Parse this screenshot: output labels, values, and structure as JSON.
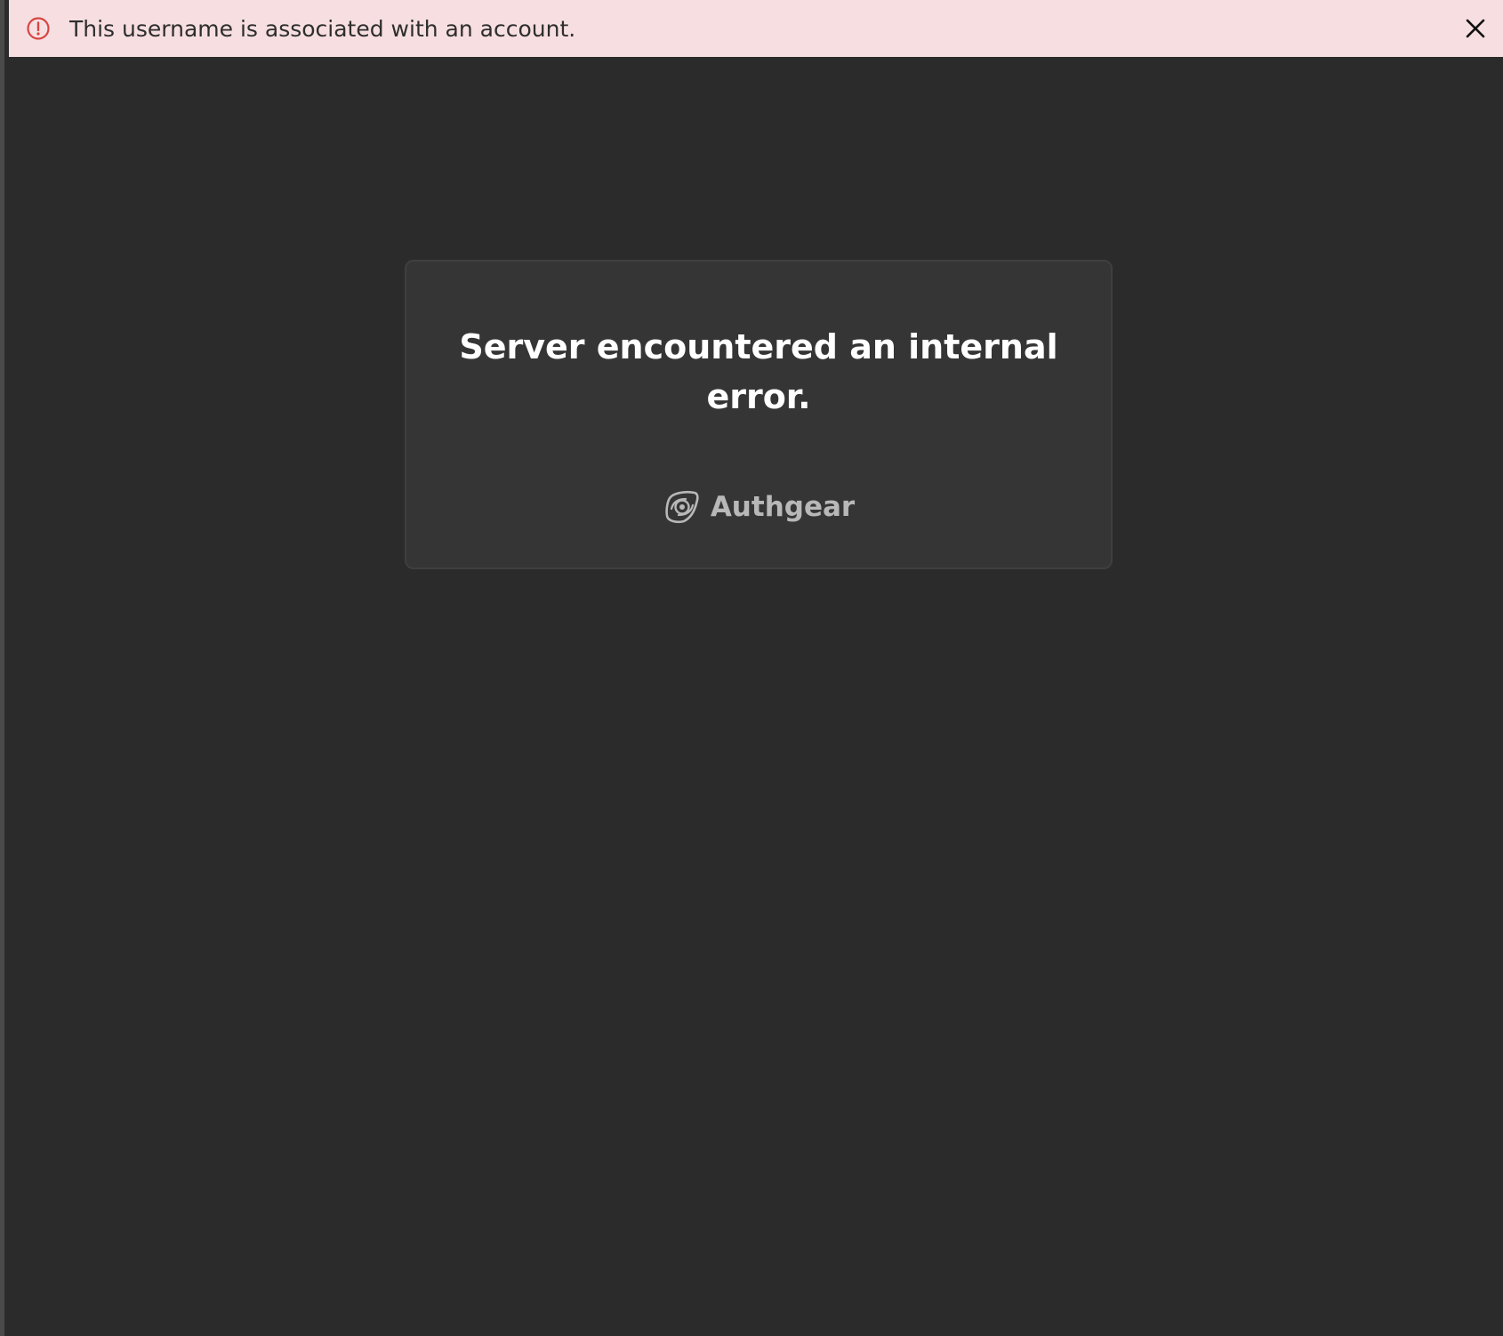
{
  "banner": {
    "message": "This username is associated with an account.",
    "icon": "alert-circle-icon",
    "close_icon": "close-icon",
    "background_color": "#f7dfe1",
    "icon_color": "#d64545"
  },
  "card": {
    "title": "Server encountered an internal error.",
    "brand_name": "Authgear",
    "brand_icon": "authgear-logo-icon"
  }
}
